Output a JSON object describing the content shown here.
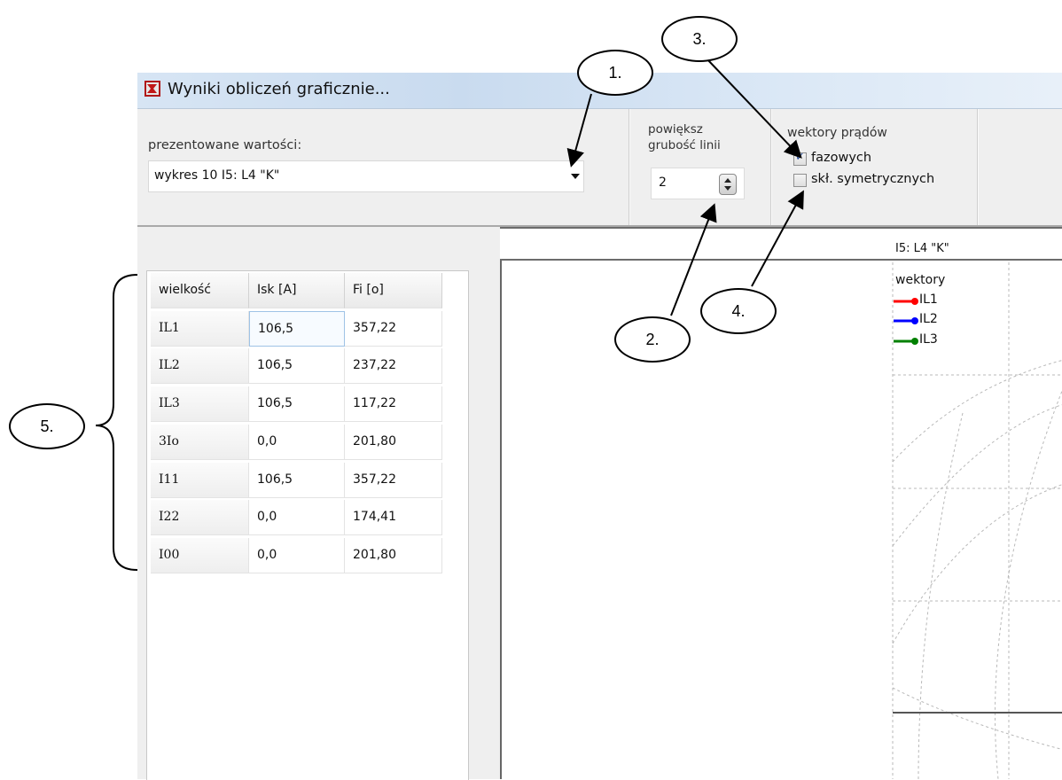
{
  "window": {
    "title": "Wyniki obliczeń graficznie..."
  },
  "toolbar": {
    "presented_label": "prezentowane wartości:",
    "combo_value": "wykres 10  I5: L4 \"K\"",
    "line_label_1": "powiększ",
    "line_label_2": "grubość linii",
    "line_width_value": "2",
    "vectors_label": "wektory prądów",
    "phase_label": "fazowych",
    "phase_checked": true,
    "symmetric_label": "skł. symetrycznych",
    "symmetric_checked": false
  },
  "table": {
    "headers": [
      "wielkość",
      "Isk [A]",
      "Fi [o]"
    ],
    "rows": [
      [
        "IL1",
        "106,5",
        "357,22"
      ],
      [
        "IL2",
        "106,5",
        "237,22"
      ],
      [
        "IL3",
        "106,5",
        "117,22"
      ],
      [
        "3Io",
        "0,0",
        "201,80"
      ],
      [
        "I11",
        "106,5",
        "357,22"
      ],
      [
        "I22",
        "0,0",
        "174,41"
      ],
      [
        "I00",
        "0,0",
        "201,80"
      ]
    ]
  },
  "chart": {
    "title": "I5: L4 \"K\"",
    "legend_title": "wektory",
    "legend": [
      {
        "label": "IL1",
        "color": "#ff0000"
      },
      {
        "label": "IL2",
        "color": "#0000ff"
      },
      {
        "label": "IL3",
        "color": "#008000"
      }
    ]
  },
  "callouts": [
    "1.",
    "2.",
    "3.",
    "4.",
    "5."
  ],
  "icons": {
    "app": "app-icon",
    "dropdown": "chevron-down-icon",
    "spinner": "spin-arrows-icon"
  }
}
